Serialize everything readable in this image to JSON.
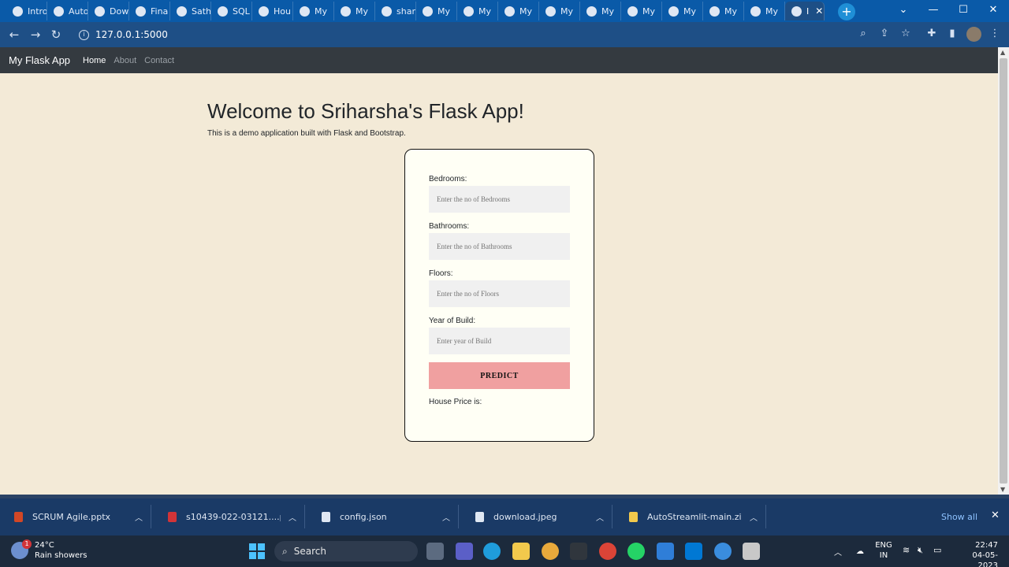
{
  "browser": {
    "tabs": [
      {
        "label": "Intro",
        "icon": "github-icon"
      },
      {
        "label": "Auto",
        "icon": "openai-icon"
      },
      {
        "label": "Dow",
        "icon": "amazon-icon"
      },
      {
        "label": "Fina",
        "icon": "notebook-icon"
      },
      {
        "label": "Sath",
        "icon": "notebook-icon"
      },
      {
        "label": "SQL",
        "icon": "cloud-icon"
      },
      {
        "label": "Hou",
        "icon": "globe-icon"
      },
      {
        "label": "My",
        "icon": "globe-icon"
      },
      {
        "label": "My",
        "icon": "globe-icon"
      },
      {
        "label": "shar",
        "icon": "google-icon"
      },
      {
        "label": "My",
        "icon": "globe-icon"
      },
      {
        "label": "My",
        "icon": "globe-icon"
      },
      {
        "label": "My",
        "icon": "globe-icon"
      },
      {
        "label": "My",
        "icon": "globe-icon"
      },
      {
        "label": "My",
        "icon": "globe-icon"
      },
      {
        "label": "My",
        "icon": "globe-icon"
      },
      {
        "label": "My",
        "icon": "globe-icon"
      },
      {
        "label": "My",
        "icon": "globe-icon"
      },
      {
        "label": "My",
        "icon": "globe-icon"
      }
    ],
    "active_tab": {
      "label": "I",
      "close": "✕"
    },
    "new_tab": "+",
    "url": "127.0.0.1:5000"
  },
  "app": {
    "brand": "My Flask App",
    "nav": [
      {
        "label": "Home",
        "active": true
      },
      {
        "label": "About",
        "active": false
      },
      {
        "label": "Contact",
        "active": false
      }
    ],
    "title": "Welcome to Sriharsha's Flask App!",
    "lead": "This is a demo application built with Flask and Bootstrap.",
    "form": {
      "bedrooms_label": "Bedrooms:",
      "bedrooms_placeholder": "Enter the no of Bedrooms",
      "bathrooms_label": "Bathrooms:",
      "bathrooms_placeholder": "Enter the no of Bathrooms",
      "floors_label": "Floors:",
      "floors_placeholder": "Enter the no of Floors",
      "year_label": "Year of Build:",
      "year_placeholder": "Enter year of Build",
      "predict_label": "PREDICT",
      "result_label": "House Price is:"
    }
  },
  "downloads": {
    "items": [
      {
        "name": "SCRUM Agile.pptx",
        "icon": "powerpoint-icon",
        "color": "#d24726"
      },
      {
        "name": "s10439-022-03121....pdf",
        "icon": "pdf-icon",
        "color": "#d13438"
      },
      {
        "name": "config.json",
        "icon": "file-icon",
        "color": "#dfe7f3"
      },
      {
        "name": "download.jpeg",
        "icon": "image-file-icon",
        "color": "#dfe7f3"
      },
      {
        "name": "AutoStreamlit-main.zip",
        "icon": "folder-zip-icon",
        "color": "#f2c94c"
      }
    ],
    "show_all": "Show all"
  },
  "taskbar": {
    "weather_temp": "24°C",
    "weather_desc": "Rain showers",
    "weather_badge": "1",
    "search_label": "Search",
    "lang_line1": "ENG",
    "lang_line2": "IN",
    "time": "22:47",
    "date": "04-05-2023"
  }
}
